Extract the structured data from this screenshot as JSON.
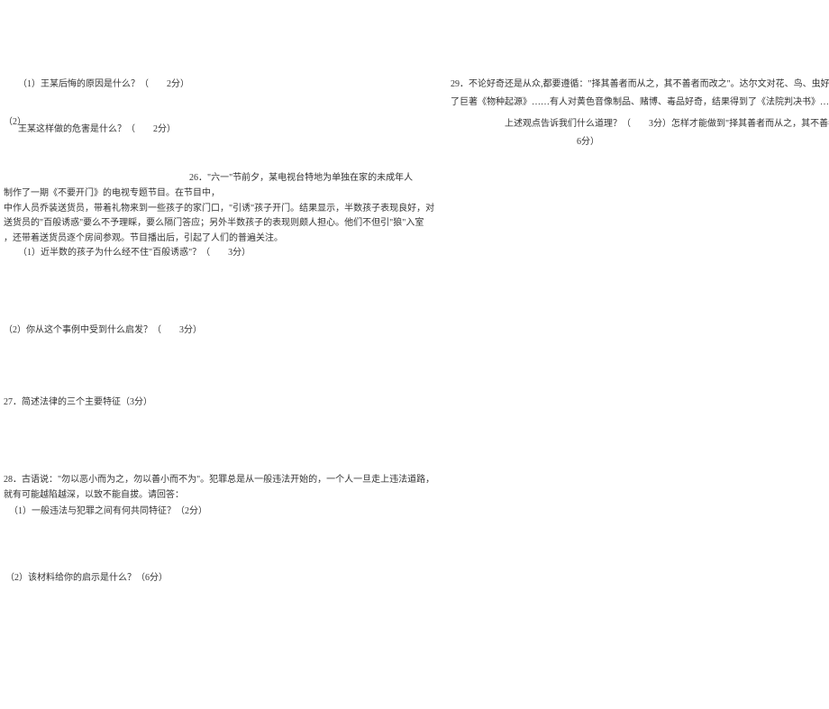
{
  "q25": {
    "sub1": "（1）王某后悔的原因是什么？（　　2分）",
    "sub2_prefix": "（2）",
    "sub2": "王某这样做的危害是什么？（　　2分）"
  },
  "q26": {
    "intro": "26．\"六一\"节前夕，某电视台特地为单独在家的未成年人",
    "line2": "制作了一期《不要开门》的电视专题节目。在节目中，",
    "line3": "中作人员乔装送货员，带着礼物来到一些孩子的家门口，\"引诱\"孩子开门。结果显示，半数孩子表现良好，对",
    "line4": "送货员的\"百般诱惑\"要么不予理睬，要么隔门答应；另外半数孩子的表现则颇人担心。他们不但引\"狼\"入室",
    "line5": "，还带着送货员逐个房间参观。节目播出后，引起了人们的普遍关注。",
    "sub1": "（1）近半数的孩子为什么经不住\"百般诱惑\"？（　　3分）",
    "sub2": "（2）你从这个事例中受到什么启发？（　　3分）"
  },
  "q27": {
    "text": "27．简述法律的三个主要特征（3分）"
  },
  "q28": {
    "line1": "28．古语说：\"勿以恶小而为之，勿以善小而不为\"。犯罪总是从一般违法开始的，一个人一旦走上违法道路，",
    "line2": "就有可能越陷越深，以致不能自拔。请回答：",
    "sub1": "（1）一般违法与犯罪之间有何共同特征？（2分）",
    "sub2": "（2）该材料给你的启示是什么？（6分）"
  },
  "q29": {
    "line1": "29．不论好奇还是从众,都要遵循：\"择其善者而从之，其不善者而改之\"。达尔文对花、鸟、虫好奇，结果写出",
    "line2": "了巨著《物种起源》……有人对黄色音像制品、赌博、毒品好奇，结果得到了《法院判决书》……",
    "line3": "上述观点告诉我们什么道理？（　　3分）怎样才能做到\"择其善者而从之，其不善者而改之\"　　　　　　　？（",
    "line4": "6分）"
  }
}
